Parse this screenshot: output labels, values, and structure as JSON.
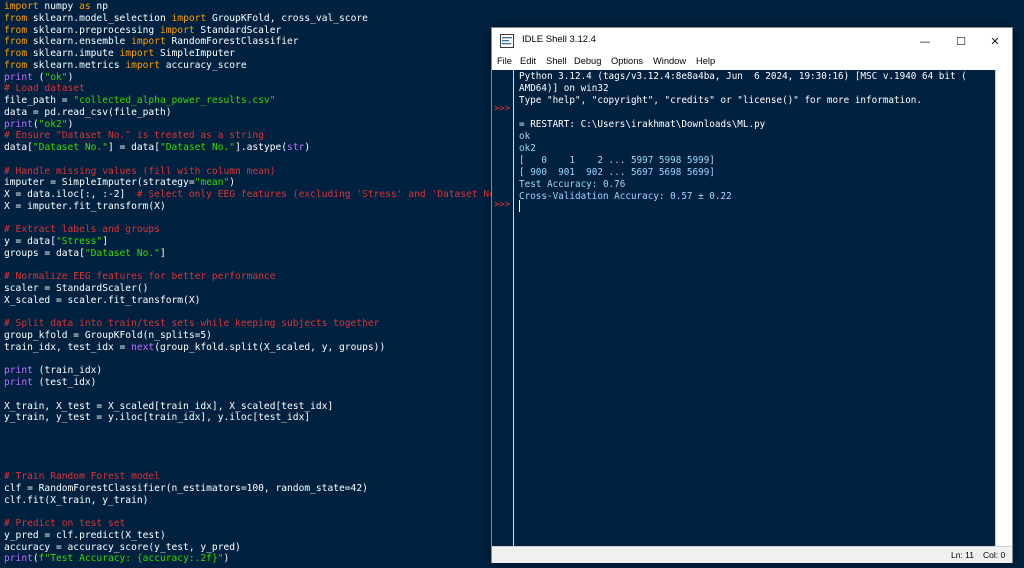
{
  "editor": {
    "lines": [
      [
        {
          "c": "kw",
          "t": "import"
        },
        {
          "c": "fn",
          "t": " numpy "
        },
        {
          "c": "kw",
          "t": "as"
        },
        {
          "c": "fn",
          "t": " np"
        }
      ],
      [
        {
          "c": "kw",
          "t": "from"
        },
        {
          "c": "fn",
          "t": " sklearn.model_selection "
        },
        {
          "c": "kw",
          "t": "import"
        },
        {
          "c": "fn",
          "t": " GroupKFold, cross_val_score"
        }
      ],
      [
        {
          "c": "kw",
          "t": "from"
        },
        {
          "c": "fn",
          "t": " sklearn.preprocessing "
        },
        {
          "c": "kw",
          "t": "import"
        },
        {
          "c": "fn",
          "t": " StandardScaler"
        }
      ],
      [
        {
          "c": "kw",
          "t": "from"
        },
        {
          "c": "fn",
          "t": " sklearn.ensemble "
        },
        {
          "c": "kw",
          "t": "import"
        },
        {
          "c": "fn",
          "t": " RandomForestClassifier"
        }
      ],
      [
        {
          "c": "kw",
          "t": "from"
        },
        {
          "c": "fn",
          "t": " sklearn.impute "
        },
        {
          "c": "kw",
          "t": "import"
        },
        {
          "c": "fn",
          "t": " SimpleImputer"
        }
      ],
      [
        {
          "c": "kw",
          "t": "from"
        },
        {
          "c": "fn",
          "t": " sklearn.metrics "
        },
        {
          "c": "kw",
          "t": "import"
        },
        {
          "c": "fn",
          "t": " accuracy_score"
        }
      ],
      [
        {
          "c": "bi",
          "t": "print"
        },
        {
          "c": "fn",
          "t": " ("
        },
        {
          "c": "st",
          "t": "\"ok\""
        },
        {
          "c": "fn",
          "t": ")"
        }
      ],
      [
        {
          "c": "cm",
          "t": "# Load dataset"
        }
      ],
      [
        {
          "c": "fn",
          "t": "file_path = "
        },
        {
          "c": "st",
          "t": "\"collected_alpha_power_results.csv\""
        }
      ],
      [
        {
          "c": "fn",
          "t": "data = pd.read_csv(file_path)"
        }
      ],
      [
        {
          "c": "bi",
          "t": "print"
        },
        {
          "c": "fn",
          "t": "("
        },
        {
          "c": "st",
          "t": "\"ok2\""
        },
        {
          "c": "fn",
          "t": ")"
        }
      ],
      [
        {
          "c": "cm",
          "t": "# Ensure \"Dataset No.\" is treated as a string"
        }
      ],
      [
        {
          "c": "fn",
          "t": "data["
        },
        {
          "c": "st",
          "t": "\"Dataset No.\""
        },
        {
          "c": "fn",
          "t": "] = data["
        },
        {
          "c": "st",
          "t": "\"Dataset No.\""
        },
        {
          "c": "fn",
          "t": "].astype("
        },
        {
          "c": "bi",
          "t": "str"
        },
        {
          "c": "fn",
          "t": ")"
        }
      ],
      [
        {
          "c": "fn",
          "t": ""
        }
      ],
      [
        {
          "c": "cm",
          "t": "# Handle missing values (fill with column mean)"
        }
      ],
      [
        {
          "c": "fn",
          "t": "imputer = SimpleImputer(strategy="
        },
        {
          "c": "st",
          "t": "\"mean\""
        },
        {
          "c": "fn",
          "t": ")"
        }
      ],
      [
        {
          "c": "fn",
          "t": "X = data.iloc[:, :-2]  "
        },
        {
          "c": "cm",
          "t": "# Select only EEG features (excluding 'Stress' and 'Dataset No.')"
        }
      ],
      [
        {
          "c": "fn",
          "t": "X = imputer.fit_transform(X)"
        }
      ],
      [
        {
          "c": "fn",
          "t": ""
        }
      ],
      [
        {
          "c": "cm",
          "t": "# Extract labels and groups"
        }
      ],
      [
        {
          "c": "fn",
          "t": "y = data["
        },
        {
          "c": "st",
          "t": "\"Stress\""
        },
        {
          "c": "fn",
          "t": "]"
        }
      ],
      [
        {
          "c": "fn",
          "t": "groups = data["
        },
        {
          "c": "st",
          "t": "\"Dataset No.\""
        },
        {
          "c": "fn",
          "t": "]"
        }
      ],
      [
        {
          "c": "fn",
          "t": ""
        }
      ],
      [
        {
          "c": "cm",
          "t": "# Normalize EEG features for better performance"
        }
      ],
      [
        {
          "c": "fn",
          "t": "scaler = StandardScaler()"
        }
      ],
      [
        {
          "c": "fn",
          "t": "X_scaled = scaler.fit_transform(X)"
        }
      ],
      [
        {
          "c": "fn",
          "t": ""
        }
      ],
      [
        {
          "c": "cm",
          "t": "# Split data into train/test sets while keeping subjects together"
        }
      ],
      [
        {
          "c": "fn",
          "t": "group_kfold = GroupKFold(n_splits=5)"
        }
      ],
      [
        {
          "c": "fn",
          "t": "train_idx, test_idx = "
        },
        {
          "c": "bi",
          "t": "next"
        },
        {
          "c": "fn",
          "t": "(group_kfold.split(X_scaled, y, groups))"
        }
      ],
      [
        {
          "c": "fn",
          "t": ""
        }
      ],
      [
        {
          "c": "bi",
          "t": "print"
        },
        {
          "c": "fn",
          "t": " (train_idx)"
        }
      ],
      [
        {
          "c": "bi",
          "t": "print"
        },
        {
          "c": "fn",
          "t": " (test_idx)"
        }
      ],
      [
        {
          "c": "fn",
          "t": ""
        }
      ],
      [
        {
          "c": "fn",
          "t": "X_train, X_test = X_scaled[train_idx], X_scaled[test_idx]"
        }
      ],
      [
        {
          "c": "fn",
          "t": "y_train, y_test = y.iloc[train_idx], y.iloc[test_idx]"
        }
      ],
      [
        {
          "c": "fn",
          "t": ""
        }
      ],
      [
        {
          "c": "fn",
          "t": ""
        }
      ],
      [
        {
          "c": "fn",
          "t": ""
        }
      ],
      [
        {
          "c": "fn",
          "t": ""
        }
      ],
      [
        {
          "c": "cm",
          "t": "# Train Random Forest model"
        }
      ],
      [
        {
          "c": "fn",
          "t": "clf = RandomForestClassifier(n_estimators=100, random_state=42)"
        }
      ],
      [
        {
          "c": "fn",
          "t": "clf.fit(X_train, y_train)"
        }
      ],
      [
        {
          "c": "fn",
          "t": ""
        }
      ],
      [
        {
          "c": "cm",
          "t": "# Predict on test set"
        }
      ],
      [
        {
          "c": "fn",
          "t": "y_pred = clf.predict(X_test)"
        }
      ],
      [
        {
          "c": "fn",
          "t": "accuracy = accuracy_score(y_test, y_pred)"
        }
      ],
      [
        {
          "c": "bi",
          "t": "print"
        },
        {
          "c": "fn",
          "t": "("
        },
        {
          "c": "st",
          "t": "f\"Test Accuracy: {accuracy:.2f}\""
        },
        {
          "c": "fn",
          "t": ")"
        }
      ]
    ]
  },
  "idle": {
    "title": "IDLE Shell 3.12.4",
    "menu": [
      "File",
      "Edit",
      "Shell",
      "Debug",
      "Options",
      "Window",
      "Help"
    ],
    "prompt": ">>>",
    "output": [
      {
        "c": "out-white",
        "t": "Python 3.12.4 (tags/v3.12.4:8e8a4ba, Jun  6 2024, 19:30:16) [MSC v.1940 64 bit ("
      },
      {
        "c": "out-white",
        "t": "AMD64)] on win32"
      },
      {
        "c": "out-white",
        "t": "Type \"help\", \"copyright\", \"credits\" or \"license()\" for more information."
      },
      {
        "c": "out-white",
        "t": ""
      },
      {
        "c": "out-white",
        "t": "= RESTART: C:\\Users\\irakhmat\\Downloads\\ML.py"
      },
      {
        "c": "out-blue",
        "t": "ok"
      },
      {
        "c": "out-blue",
        "t": "ok2"
      },
      {
        "c": "out-blue",
        "t": "[   0    1    2 ... 5997 5998 5999]"
      },
      {
        "c": "out-blue",
        "t": "[ 900  901  902 ... 5697 5698 5699]"
      },
      {
        "c": "out-blue",
        "t": "Test Accuracy: 0.76"
      },
      {
        "c": "out-blue",
        "t": "Cross-Validation Accuracy: 0.57 ± 0.22"
      }
    ],
    "status": {
      "line": "Ln: 11",
      "col": "Col: 0"
    },
    "buttons": {
      "minimize": "—",
      "maximize": "☐",
      "close": "✕"
    }
  }
}
